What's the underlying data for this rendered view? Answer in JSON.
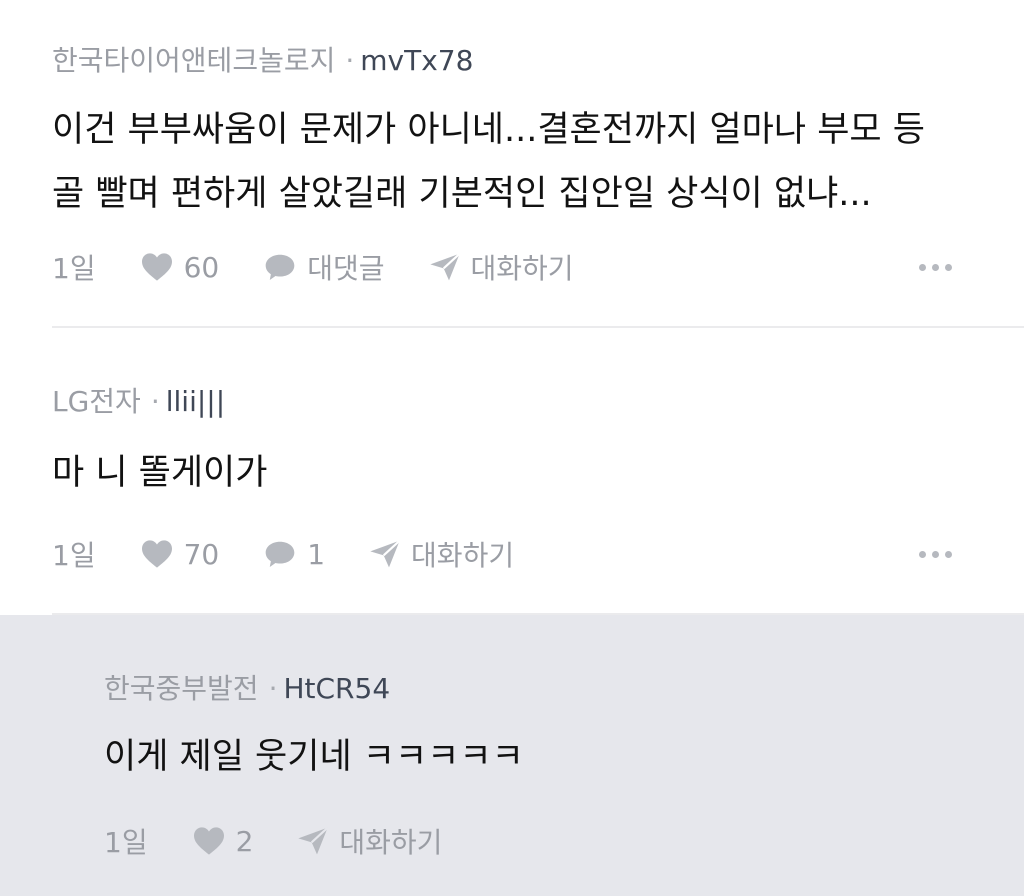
{
  "comments": [
    {
      "company": "한국타이어앤테크놀로지",
      "separator": "·",
      "nickname": "mvTx78",
      "body_line1": "이건 부부싸움이 문제가 아니네...결혼전까지 얼마나 부모 등",
      "body_line2": "골 빨며 편하게 살았길래 기본적인 집안일 상식이 없냐...",
      "time": "1일",
      "likes": "60",
      "reply_label": "대댓글",
      "chat_label": "대화하기",
      "more_icon": "more-horizontal-icon"
    },
    {
      "company": "LG전자",
      "separator": "·",
      "nickname": "llii|||",
      "body_line1": "마 니 똘게이가",
      "time": "1일",
      "likes": "70",
      "reply_count": "1",
      "chat_label": "대화하기",
      "more_icon": "more-horizontal-icon"
    }
  ],
  "reply": {
    "company": "한국중부발전",
    "separator": "·",
    "nickname": "HtCR54",
    "body_line1": "이게 제일 웃기네 ㅋㅋㅋㅋㅋ",
    "time": "1일",
    "likes": "2",
    "chat_label": "대화하기"
  },
  "colors": {
    "meta_text": "#9a9da4",
    "nickname": "#3f4756",
    "body_text": "#121212",
    "reply_background": "#e6e7ec",
    "icon": "#b6b9bf"
  }
}
